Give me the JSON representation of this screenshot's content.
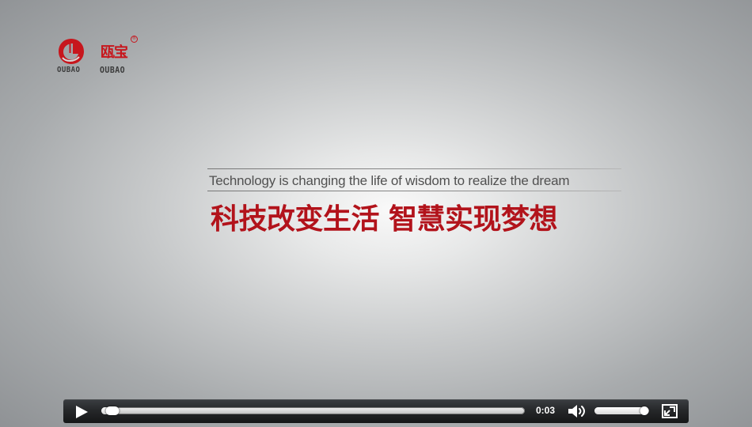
{
  "brand": {
    "logo_chinese": "瓯宝",
    "logo_english_left": "OUBAO",
    "logo_english_right": "OUBAO",
    "registered_mark": "®",
    "brand_red": "#c7161d"
  },
  "video": {
    "slogan_english": "Technology is changing the life of wisdom to realize the dream",
    "slogan_chinese": "科技改变生活  智慧实现梦想",
    "current_time": "0:03",
    "progress_fraction": 0.026,
    "volume_fraction": 0.92,
    "background_colors": [
      "#f9f9f9",
      "#8f9295"
    ],
    "control_bar_color": "#252729"
  },
  "icons": {
    "play": "play-icon",
    "volume": "volume-icon",
    "fullscreen": "fullscreen-icon",
    "logo": "oubao-logo-mark"
  }
}
